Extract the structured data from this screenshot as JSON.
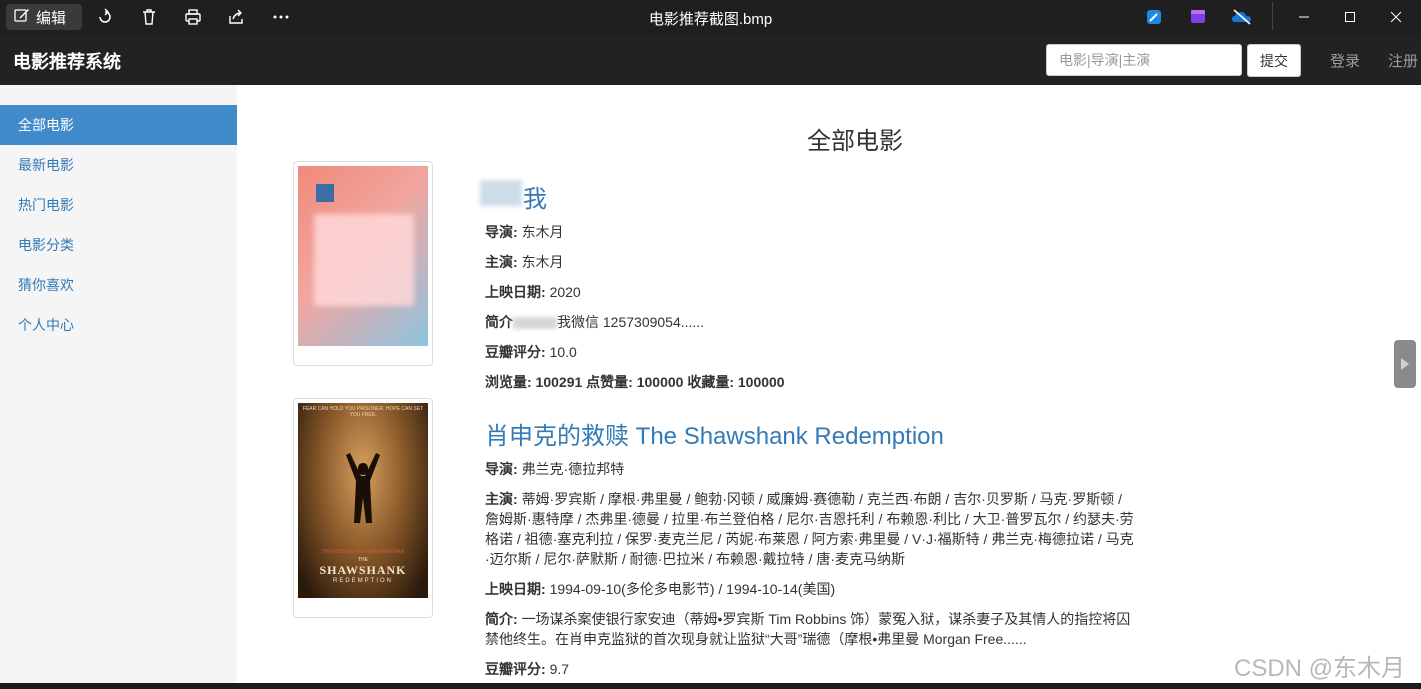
{
  "viewer": {
    "edit_label": "编辑",
    "file_title": "电影推荐截图.bmp",
    "toolbar_icons": [
      "rotate-icon",
      "delete-icon",
      "print-icon",
      "share-icon",
      "more-icon"
    ],
    "tray_icons": [
      "edit-app-icon",
      "clipchamp-icon",
      "onedrive-icon"
    ],
    "window_controls": [
      "minimize-icon",
      "maximize-icon",
      "close-icon"
    ]
  },
  "navbar": {
    "brand": "电影推荐系统",
    "search_placeholder": "电影|导演|主演",
    "submit_label": "提交",
    "login_label": "登录",
    "register_label": "注册"
  },
  "sidebar": {
    "items": [
      {
        "label": "全部电影",
        "active": true
      },
      {
        "label": "最新电影",
        "active": false
      },
      {
        "label": "热门电影",
        "active": false
      },
      {
        "label": "电影分类",
        "active": false
      },
      {
        "label": "猜你喜欢",
        "active": false
      },
      {
        "label": "个人中心",
        "active": false
      }
    ]
  },
  "main": {
    "page_title": "全部电影",
    "movies": [
      {
        "title": "我",
        "director_label": "导演:",
        "director": "东木月",
        "cast_label": "主演:",
        "cast": "东木月",
        "release_label": "上映日期:",
        "release": "2020",
        "summary_label": "简介",
        "summary": "我微信 1257309054......",
        "rating_label": "豆瓣评分:",
        "rating": "10.0",
        "stats": "浏览量: 100291 点赞量: 100000 收藏量: 100000"
      },
      {
        "title": "肖申克的救赎 The Shawshank Redemption",
        "director_label": "导演:",
        "director": "弗兰克·德拉邦特",
        "cast_label": "主演:",
        "cast": "蒂姆·罗宾斯 / 摩根·弗里曼 / 鲍勃·冈顿 / 威廉姆·赛德勒 / 克兰西·布朗 / 吉尔·贝罗斯 / 马克·罗斯顿 / 詹姆斯·惠特摩 / 杰弗里·德曼 / 拉里·布兰登伯格 / 尼尔·吉恩托利 / 布赖恩·利比 / 大卫·普罗瓦尔 / 约瑟夫·劳格诺 / 祖德·塞克利拉 / 保罗·麦克兰尼 / 芮妮·布莱恩 / 阿方索·弗里曼 / V·J·福斯特 / 弗兰克·梅德拉诺 / 马克·迈尔斯 / 尼尔·萨默斯 / 耐德·巴拉米 / 布赖恩·戴拉特 / 唐·麦克马纳斯",
        "release_label": "上映日期:",
        "release": "1994-09-10(多伦多电影节) / 1994-10-14(美国)",
        "summary_label": "简介:",
        "summary": "一场谋杀案使银行家安迪（蒂姆•罗宾斯 Tim Robbins 饰）蒙冤入狱，谋杀妻子及其情人的指控将囚禁他终生。在肖申克监狱的首次现身就让监狱“大哥”瑞德（摩根•弗里曼 Morgan Free......",
        "rating_label": "豆瓣评分:",
        "rating": "9.7",
        "poster_top": "FEAR CAN HOLD YOU PRISONER. HOPE CAN SET YOU FREE.",
        "poster_actors": "TIM ROBBINS  MORGAN FREEMAN",
        "poster_the": "THE",
        "poster_title": "SHAWSHANK",
        "poster_sub": "REDEMPTION"
      }
    ]
  },
  "watermark": "CSDN @东木月"
}
